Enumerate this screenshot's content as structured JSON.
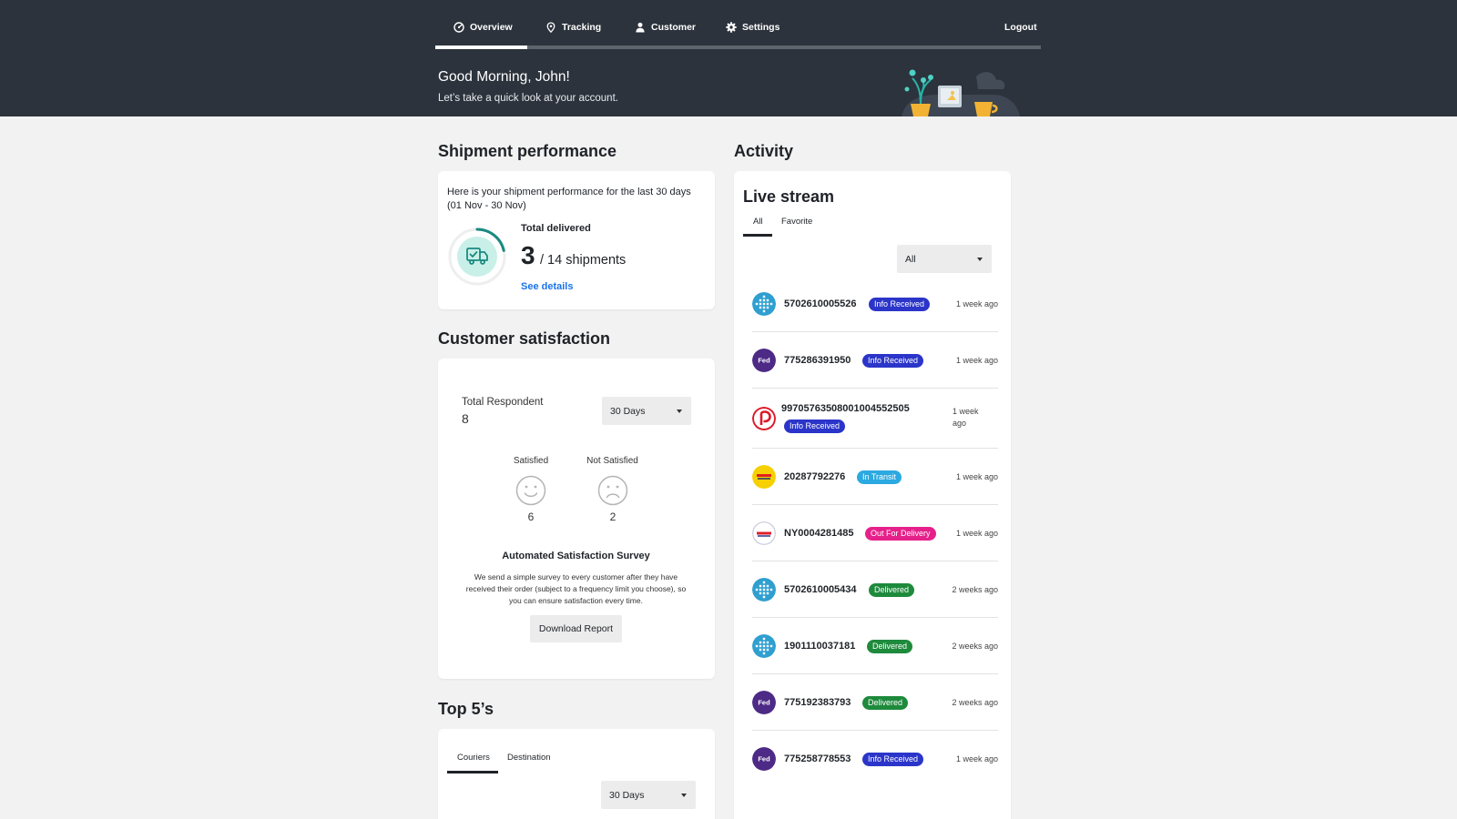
{
  "nav": {
    "items": [
      {
        "label": "Overview",
        "icon": "overview-icon"
      },
      {
        "label": "Tracking",
        "icon": "location-pin-icon"
      },
      {
        "label": "Customer",
        "icon": "user-icon"
      },
      {
        "label": "Settings",
        "icon": "gear-icon"
      }
    ],
    "active": "Overview",
    "logout_label": "Logout"
  },
  "header": {
    "greeting": "Good Morning, John!",
    "subtitle": "Let’s take a quick look at your account."
  },
  "shipment_performance": {
    "title": "Shipment performance",
    "description": "Here is your shipment performance for the last 30 days (01 Nov - 30 Nov)",
    "total_label": "Total delivered",
    "delivered": "3",
    "total_text": "/ 14 shipments",
    "delivered_fraction": 0.214,
    "see_details": "See details"
  },
  "customer_satisfaction": {
    "title": "Customer satisfaction",
    "respondent_label": "Total Respondent",
    "respondent_count": "8",
    "period": "30 Days",
    "satisfied_label": "Satisfied",
    "satisfied_count": "6",
    "not_satisfied_label": "Not Satisfied",
    "not_satisfied_count": "2",
    "survey_title": "Automated Satisfaction Survey",
    "survey_text": "We send a simple survey to every customer after they have received their order (subject to a frequency limit you choose), so you can ensure satisfaction every time.",
    "download_label": "Download Report"
  },
  "top5": {
    "title": "Top 5’s",
    "tabs": [
      "Couriers",
      "Destination"
    ],
    "active_tab": "Couriers",
    "period": "30 Days"
  },
  "activity": {
    "title": "Activity",
    "stream_title": "Live stream",
    "tabs": [
      "All",
      "Favorite"
    ],
    "active_tab": "All",
    "filter": "All",
    "rows": [
      {
        "courier": "grid-courier-logo",
        "tracking": "5702610005526",
        "status": "Info Received",
        "time": "1 week ago"
      },
      {
        "courier": "fedex-logo",
        "tracking": "775286391950",
        "status": "Info Received",
        "time": "1 week ago"
      },
      {
        "courier": "australia-post-logo",
        "tracking": "99705763508001004552505",
        "status": "Info Received",
        "time": "1 week ago"
      },
      {
        "courier": "yellow-courier-logo",
        "tracking": "20287792276",
        "status": "In Transit",
        "time": "1 week ago"
      },
      {
        "courier": "fastway-logo",
        "tracking": "NY0004281485",
        "status": "Out For Delivery",
        "time": "1 week ago"
      },
      {
        "courier": "grid-courier-logo",
        "tracking": "5702610005434",
        "status": "Delivered",
        "time": "2 weeks ago"
      },
      {
        "courier": "grid-courier-logo",
        "tracking": "1901110037181",
        "status": "Delivered",
        "time": "2 weeks ago"
      },
      {
        "courier": "fedex-logo",
        "tracking": "775192383793",
        "status": "Delivered",
        "time": "2 weeks ago"
      },
      {
        "courier": "fedex-logo",
        "tracking": "775258778553",
        "status": "Info Received",
        "time": "1 week ago"
      }
    ]
  },
  "colors": {
    "header_bg": "#2c333c",
    "page_bg": "#f2f2f2",
    "link": "#1a73e8",
    "info_received": "#2b35c9",
    "in_transit": "#2ba9e0",
    "out_for_delivery": "#e6208a",
    "delivered": "#1e8a3c",
    "ring": "#1a8a80"
  }
}
